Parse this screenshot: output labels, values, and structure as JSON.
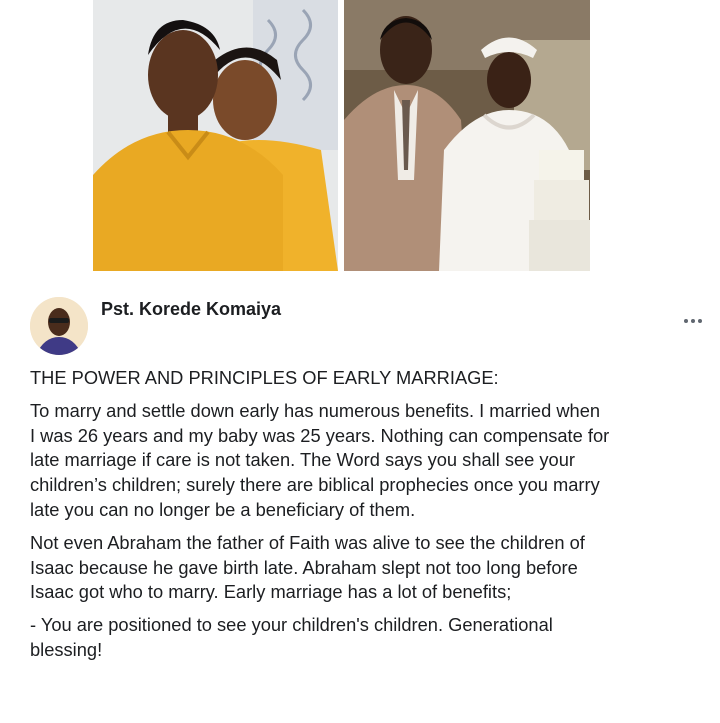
{
  "images": {
    "left_photo": "couple-photo-yellow-shirts",
    "right_photo": "wedding-photo"
  },
  "post": {
    "author": "Pst. Korede Komaiya",
    "more_icon": "more-options-icon",
    "heading": "THE POWER AND PRINCIPLES OF EARLY MARRIAGE:",
    "paragraphs": [
      "To marry and settle down early has numerous benefits. I married when\nI was 26 years and my baby was 25 years. Nothing can compensate for\nlate marriage if care is not taken. The Word says you shall see your\nchildren’s children; surely there are biblical prophecies once you marry\nlate you can no longer be a beneficiary of them.",
      "Not even Abraham the father of Faith was alive to see the children of\nIsaac because he gave birth late. Abraham slept not too long before\nIsaac got who to marry. Early marriage has a lot of benefits;",
      "- You are positioned to see your children's children. Generational\nblessing!"
    ]
  },
  "colors": {
    "text": "#1c1e21",
    "muted": "#606770",
    "yellow_shirt": "#e9a923"
  }
}
